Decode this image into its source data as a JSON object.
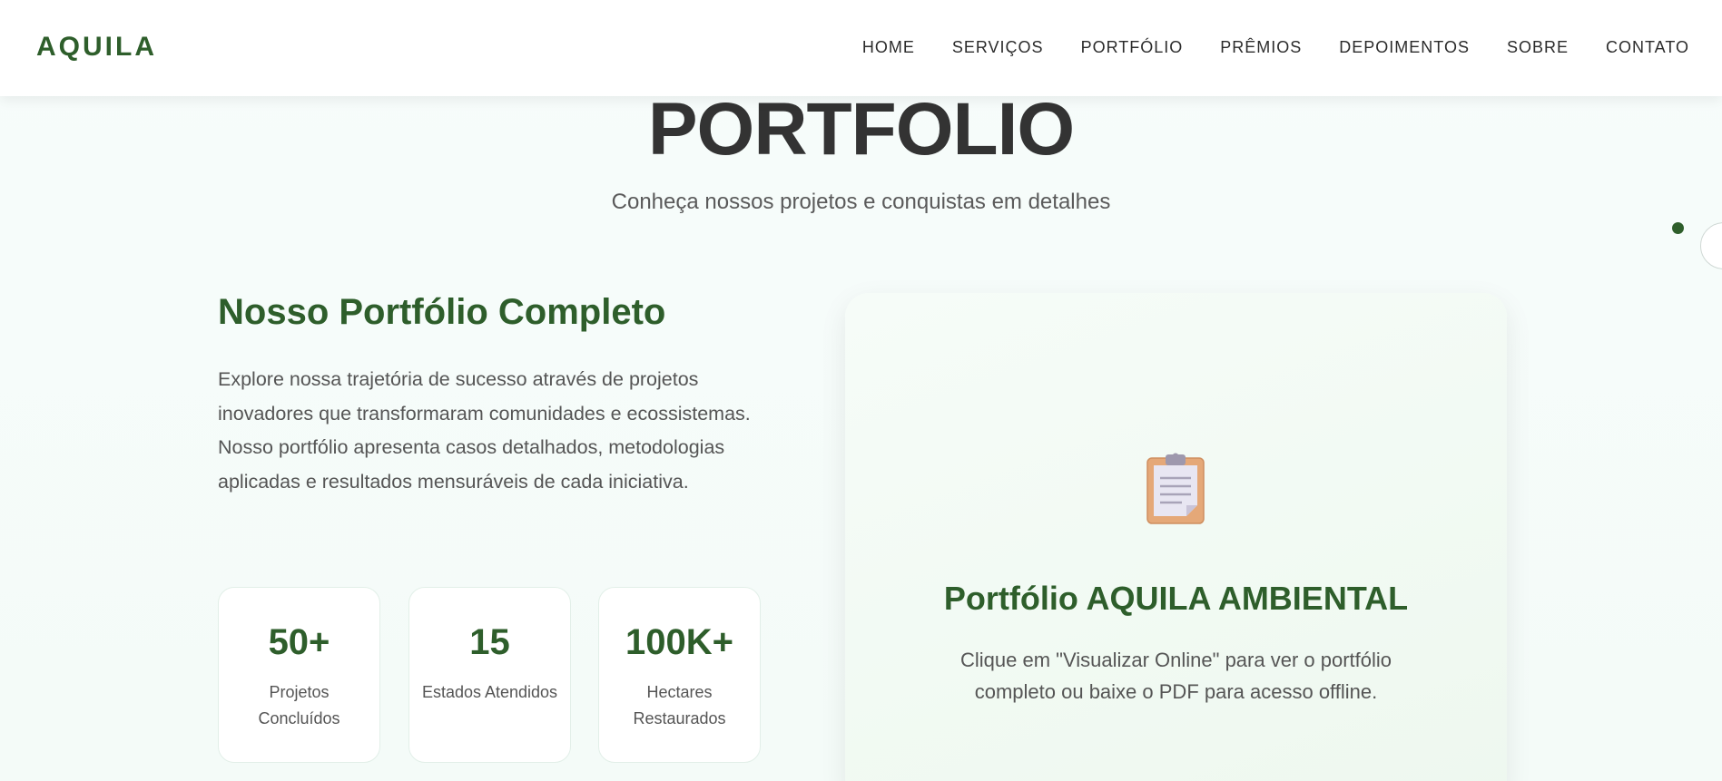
{
  "navbar": {
    "brand": "AQUILA",
    "links": [
      "HOME",
      "SERVIÇOS",
      "PORTFÓLIO",
      "PRÊMIOS",
      "DEPOIMENTOS",
      "SOBRE",
      "CONTATO"
    ]
  },
  "hero": {
    "title": "PORTFOLIO",
    "subtitle": "Conheça nossos projetos e conquistas em detalhes"
  },
  "intro": {
    "heading": "Nosso Portfólio Completo",
    "text": "Explore nossa trajetória de sucesso através de projetos inovadores que transformaram comunidades e ecossistemas. Nosso portfólio apresenta casos detalhados, metodologias aplicadas e resultados mensuráveis de cada iniciativa."
  },
  "stats": [
    {
      "value": "50+",
      "label": "Projetos Concluídos"
    },
    {
      "value": "15",
      "label": "Estados Atendidos"
    },
    {
      "value": "100K+",
      "label": "Hectares Restaurados"
    }
  ],
  "card": {
    "icon": "clipboard-icon",
    "title": "Portfólio AQUILA AMBIENTAL",
    "text": "Clique em \"Visualizar Online\" para ver o portfólio completo ou baixe o PDF para acesso offline."
  },
  "colors": {
    "brand_green": "#2e5e2b",
    "text_dark": "#333333",
    "text_muted": "#555555",
    "background": "#f6fcfa"
  }
}
